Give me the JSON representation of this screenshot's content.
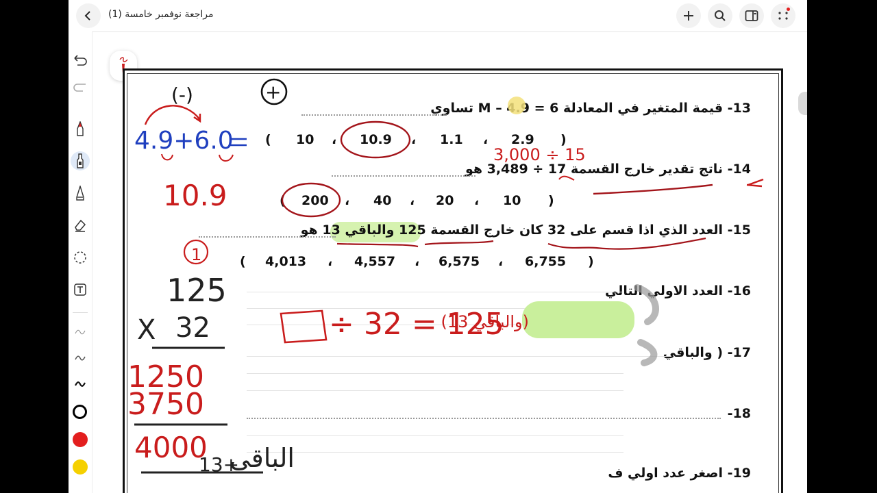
{
  "header": {
    "title": "مراجعة نوفمبر خامسة (1)"
  },
  "toolbar": {
    "tools": [
      {
        "icon": "undo-icon"
      },
      {
        "icon": "redo-icon"
      },
      {
        "icon": "pen-icon"
      },
      {
        "icon": "highlighter-icon"
      },
      {
        "icon": "pencil-icon"
      },
      {
        "icon": "eraser-icon"
      },
      {
        "icon": "lasso-icon"
      },
      {
        "icon": "text-icon"
      }
    ],
    "colors": [
      "#000000",
      "#e31e1e",
      "#f5d000"
    ]
  },
  "worksheet": {
    "q13": {
      "number": "13-",
      "text": "قيمة المتغير  في المعادلة 6 = M – 4.9 تساوي"
    },
    "q13_options": [
      "10",
      "10.9",
      "1.1",
      "2.9"
    ],
    "q14": {
      "number": "14-",
      "text": "ناتج تقدير خارج القسمة 17 ÷ 3,489 هو"
    },
    "q14_options": [
      "200",
      "40",
      "20",
      "10"
    ],
    "q15": {
      "number": "15-",
      "text": "العدد الذي اذا قسم على 32 كان خارج القسمة 125 والباقي 13 هو"
    },
    "q15_options": [
      "4,013",
      "4,557",
      "6,575",
      "6,755"
    ],
    "q16": {
      "number": "16-",
      "text": "العدد الاولي التالي"
    },
    "q17": {
      "number": "17-",
      "text": "( والباقي"
    },
    "q18": {
      "number": "18-",
      "text": ""
    },
    "q19": {
      "number": "19-",
      "text": "اصغر عدد اولي ف"
    }
  },
  "annotations": {
    "minus_sign": "(-)",
    "plus_sign": "+",
    "sum_expr": "4.9+6.0",
    "sum_result": "10.9",
    "estimate": "3,000 ÷ 15",
    "step_one": "1",
    "mult_top": "125",
    "mult_x": "X",
    "mult_bottom": "32",
    "partial1": "1250",
    "partial2": "3750",
    "product": "4000",
    "plus_rem": "13+",
    "remainder_word": "الباقي",
    "equation": "÷ 32 = 125",
    "remainder_note": "(والباقي 13)"
  }
}
